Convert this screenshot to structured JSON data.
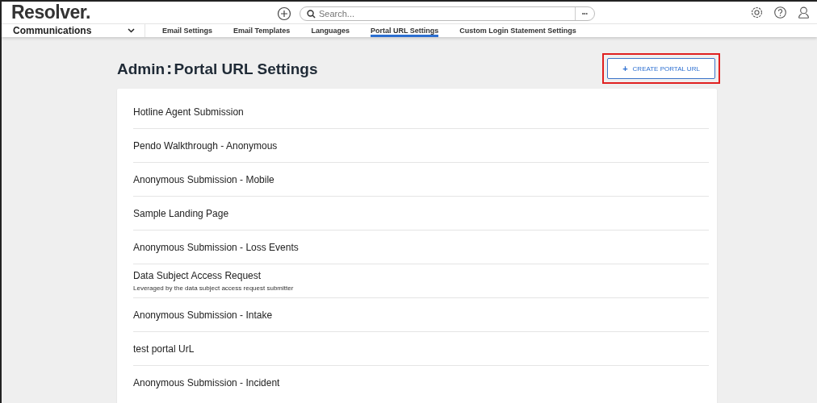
{
  "header": {
    "logo": "Resolver.",
    "search": {
      "placeholder": "Search..."
    },
    "more": "•••"
  },
  "nav": {
    "section": "Communications",
    "tabs": [
      {
        "label": "Email Settings",
        "selected": false
      },
      {
        "label": "Email Templates",
        "selected": false
      },
      {
        "label": "Languages",
        "selected": false
      },
      {
        "label": "Portal URL Settings",
        "selected": true
      },
      {
        "label": "Custom Login Statement Settings",
        "selected": false
      }
    ]
  },
  "page": {
    "title_prefix": "Admin",
    "title_separator": ":",
    "title": "Portal URL Settings",
    "create_button": {
      "icon": "+",
      "label": "CREATE PORTAL URL",
      "highlighted": true
    }
  },
  "portals": [
    {
      "name": "Hotline Agent Submission"
    },
    {
      "name": "Pendo Walkthrough - Anonymous"
    },
    {
      "name": "Anonymous Submission - Mobile"
    },
    {
      "name": "Sample Landing Page"
    },
    {
      "name": "Anonymous Submission - Loss Events"
    },
    {
      "name": "Data Subject Access Request",
      "description": "Leveraged by the data subject access request submitter"
    },
    {
      "name": "Anonymous Submission - Intake"
    },
    {
      "name": "test portal UrL"
    },
    {
      "name": "Anonymous Submission - Incident"
    }
  ]
}
